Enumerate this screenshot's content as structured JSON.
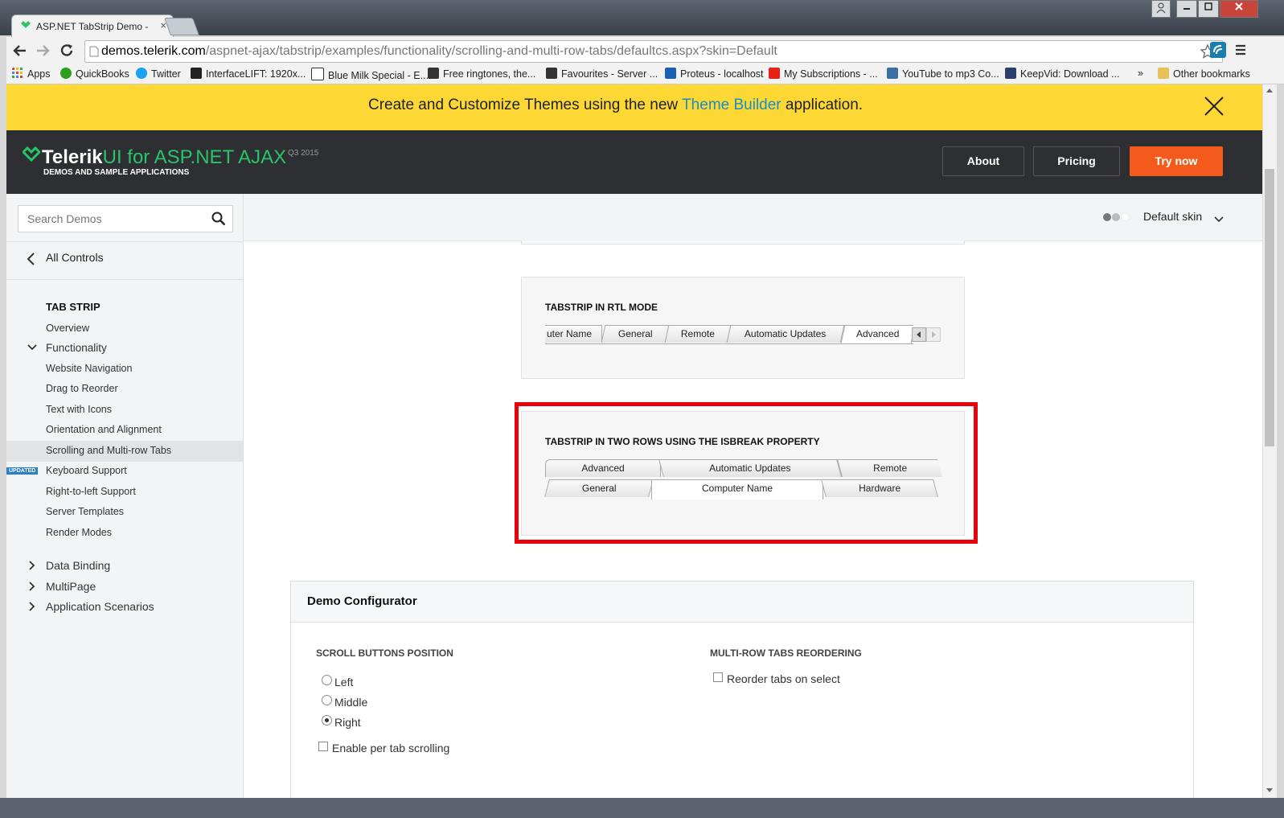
{
  "browser": {
    "tab_title": "ASP.NET TabStrip Demo -",
    "tab_close": "×",
    "url_host": "demos.telerik.com",
    "url_path": "/aspnet-ajax/tabstrip/examples/functionality/scrolling-and-multi-row-tabs/defaultcs.aspx?skin=Default",
    "bookmarks": [
      {
        "label": "Apps",
        "color": "#e0402d"
      },
      {
        "label": "QuickBooks",
        "color": "#2ca01c"
      },
      {
        "label": "Twitter",
        "color": "#1da1f2"
      },
      {
        "label": "InterfaceLIFT: 1920x...",
        "color": "#222222"
      },
      {
        "label": "Blue Milk Special - E...",
        "color": "#333333"
      },
      {
        "label": "Free ringtones, the...",
        "color": "#333333"
      },
      {
        "label": "Favourites - Server ...",
        "color": "#333333"
      },
      {
        "label": "Proteus - localhost",
        "color": "#1a5fb4"
      },
      {
        "label": "My Subscriptions - ...",
        "color": "#e62117"
      },
      {
        "label": "YouTube to mp3 Co...",
        "color": "#3a6ea5"
      },
      {
        "label": "KeepVid: Download ...",
        "color": "#2c3e6b"
      }
    ],
    "bookmarks_overflow": "»",
    "other_bookmarks": "Other bookmarks"
  },
  "banner": {
    "text_before": "Create and Customize Themes using the new ",
    "link": "Theme Builder",
    "text_after": " application."
  },
  "header": {
    "logo_brand": "Telerik",
    "logo_product": "UI for ASP.NET AJAX",
    "logo_version": "Q3 2015",
    "logo_sub": "DEMOS AND SAMPLE APPLICATIONS",
    "about": "About",
    "pricing": "Pricing",
    "try_now": "Try now"
  },
  "sidebar": {
    "search_placeholder": "Search Demos",
    "all_controls": "All Controls",
    "section": "TAB STRIP",
    "overview": "Overview",
    "functionality": "Functionality",
    "items": [
      "Website Navigation",
      "Drag to Reorder",
      "Text with Icons",
      "Orientation and Alignment",
      "Scrolling and Multi-row Tabs",
      "Keyboard Support",
      "Right-to-left Support",
      "Server Templates",
      "Render Modes"
    ],
    "updated_badge": "UPDATED",
    "groups": [
      "Data Binding",
      "MultiPage",
      "Application Scenarios"
    ]
  },
  "skin": {
    "label": "Default skin"
  },
  "demos": {
    "rtl": {
      "title": "TABSTRIP IN RTL MODE",
      "tabs": [
        "uter Name",
        "General",
        "Remote",
        "Automatic Updates",
        "Advanced"
      ]
    },
    "two_rows": {
      "title": "TABSTRIP IN TWO ROWS USING THE ISBREAK PROPERTY",
      "row1": [
        "Advanced",
        "Automatic Updates",
        "Remote"
      ],
      "row2": [
        "General",
        "Computer Name",
        "Hardware"
      ]
    }
  },
  "configurator": {
    "title": "Demo Configurator",
    "scroll_heading": "SCROLL BUTTONS POSITION",
    "options": [
      "Left",
      "Middle",
      "Right"
    ],
    "selected": "Right",
    "per_tab": "Enable per tab scrolling",
    "multi_heading": "MULTI-ROW TABS REORDERING",
    "reorder": "Reorder tabs on select"
  },
  "colors": {
    "banner_bg": "#fdd835",
    "header_bg": "#2d2f33",
    "try_now_bg": "#f55a1d",
    "highlight_border": "#e8000b",
    "logo_green": "#29c469"
  }
}
